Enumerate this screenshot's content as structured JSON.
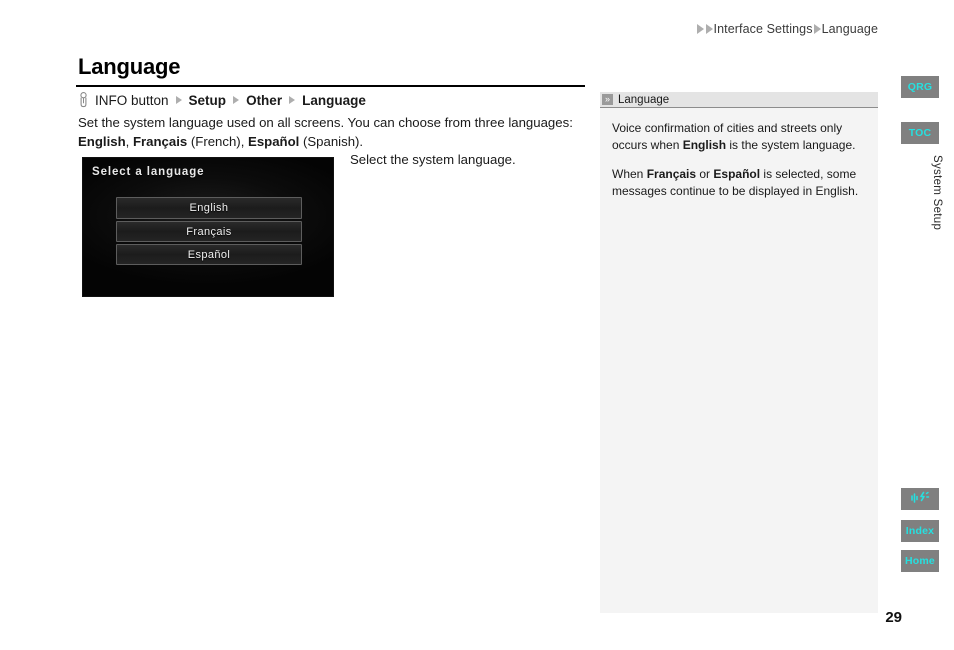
{
  "topnav": {
    "item1": "Interface Settings",
    "item2": "Language",
    "arrow_icon": "triangle-right-icon"
  },
  "header": {
    "title": "Language"
  },
  "path": {
    "button_icon": "info-button-icon",
    "button_label": "INFO button",
    "step1": "Setup",
    "step2": "Other",
    "step3": "Language",
    "separator_icon": "triangle-right-icon"
  },
  "body": {
    "text_1": "Set the system language used on all screens. You can choose from three languages:",
    "lang_en": "English",
    "sep_1": ", ",
    "lang_fr": "Français",
    "fr_note": " (French), ",
    "lang_es": "Español",
    "es_note": " (Spanish)."
  },
  "navshot": {
    "screen_title": "Select a language",
    "buttons": [
      {
        "label": "English"
      },
      {
        "label": "Français"
      },
      {
        "label": "Español"
      }
    ]
  },
  "caption": {
    "text": "Select the system language."
  },
  "note": {
    "header_icon": "double-chevron-right-icon",
    "header_label": "Language",
    "para1_a": "Voice confirmation of cities and streets only occurs when ",
    "para1_b": "English",
    "para1_c": " is the system language.",
    "para2_a": "When ",
    "para2_b": "Français",
    "para2_c": " or ",
    "para2_d": "Español",
    "para2_e": " is selected, some messages continue to be displayed in English."
  },
  "rail": {
    "qrg": "QRG",
    "toc": "TOC",
    "voice_icon": "voice-command-icon",
    "index": "Index",
    "home": "Home",
    "section_tab": "System Setup"
  },
  "footer": {
    "page_number": "29"
  },
  "colors": {
    "rail_button_bg": "#808080",
    "rail_button_text": "#25e0e0",
    "note_panel_bg": "#f4f4f4",
    "note_header_bg": "#e4e4e4",
    "arrow_gray": "#aeaeae"
  }
}
